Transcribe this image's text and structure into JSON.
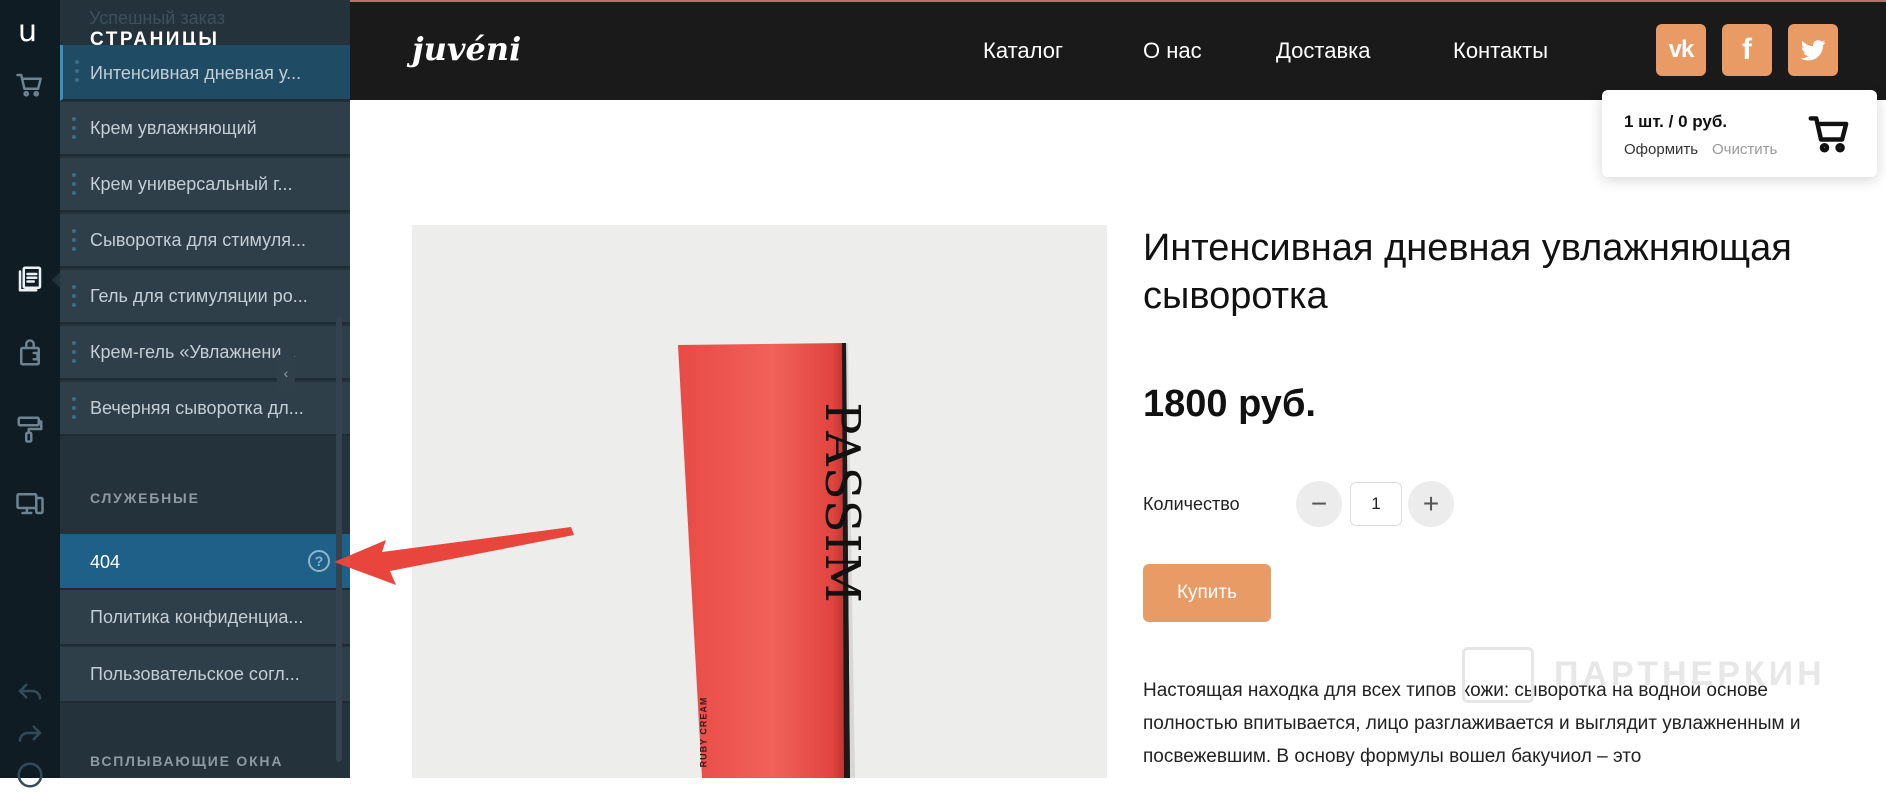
{
  "rail": {
    "logo": "u",
    "icons": [
      "cart-icon",
      "pages-icon",
      "store-icon",
      "design-roller-icon",
      "devices-icon",
      "undo-icon",
      "redo-icon",
      "help-icon"
    ]
  },
  "panel": {
    "ghost_item": "Успешный заказ",
    "heading": "СТРАНИЦЫ",
    "items": [
      {
        "label": "Интенсивная дневная у..."
      },
      {
        "label": "Крем увлажняющий"
      },
      {
        "label": "Крем универсальный г..."
      },
      {
        "label": "Сыворотка для стимуля..."
      },
      {
        "label": "Гель для стимуляции ро..."
      },
      {
        "label": "Крем-гель «Увлажнени..."
      },
      {
        "label": "Вечерняя сыворотка дл..."
      }
    ],
    "service_heading": "СЛУЖЕБНЫЕ",
    "service_items": [
      {
        "label": "404"
      },
      {
        "label": "Политика конфиденциа..."
      },
      {
        "label": "Пользовательское согл..."
      }
    ],
    "popups_heading": "ВСПЛЫВАЮЩИЕ ОКНА",
    "help_glyph": "?",
    "collapse_glyph": "‹"
  },
  "header": {
    "brand": "juvéni",
    "nav": [
      "Каталог",
      "О нас",
      "Доставка",
      "Контакты"
    ],
    "social": [
      "vk-icon",
      "facebook-icon",
      "twitter-icon"
    ],
    "vk_label": "vk",
    "fb_label": "f"
  },
  "cart": {
    "summary": "1 шт. / 0 руб.",
    "checkout": "Оформить",
    "clear": "Очистить"
  },
  "product": {
    "title": "Интенсивная дневная увлажняющая сыворотка",
    "price": "1800  руб.",
    "qty_label": "Количество",
    "qty_value": "1",
    "minus": "−",
    "plus": "+",
    "buy_label": "Купить",
    "tube_brand": "PASSIM",
    "tube_sub": "RUBY CREAM",
    "description": "Настоящая находка для всех типов кожи: сыворотка на водной основе полностью впитывается, лицо разглаживается и выглядит увлажненным и посвежевшим. В основу формулы вошел бакучиол – это"
  },
  "watermark": "ПАРТНЕРКИН",
  "colors": {
    "accent": "#e89b64",
    "panel": "#24323b",
    "selected": "#1f6089",
    "header": "#1a1a1a",
    "arrow": "#e8453c"
  }
}
